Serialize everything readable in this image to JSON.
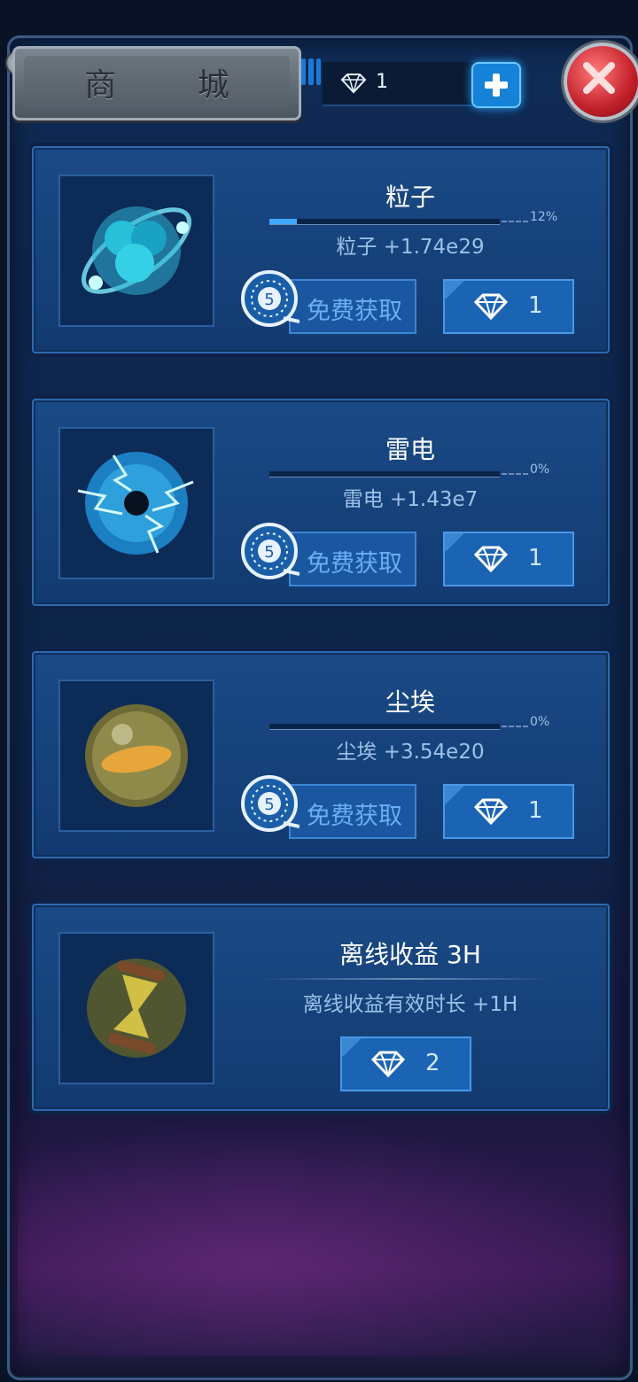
{
  "header": {
    "title": "商 城",
    "gem_count": "1"
  },
  "items": [
    {
      "name": "粒子",
      "progress_label": "12%",
      "progress": 0.12,
      "gain": "粒子  +1.74e29",
      "free_count": "5",
      "free_label": "免费获取",
      "price": "1"
    },
    {
      "name": "雷电",
      "progress_label": "0%",
      "progress": 0.0,
      "gain": "雷电  +1.43e7",
      "free_count": "5",
      "free_label": "免费获取",
      "price": "1"
    },
    {
      "name": "尘埃",
      "progress_label": "0%",
      "progress": 0.0,
      "gain": "尘埃  +3.54e20",
      "free_count": "5",
      "free_label": "免费获取",
      "price": "1"
    }
  ],
  "offline": {
    "name": "离线收益 3H",
    "desc": "离线收益有效时长  +1H",
    "price": "2"
  },
  "colors": {
    "accent": "#1683d8",
    "close": "#c2202a",
    "panel": "#123a70"
  },
  "icons": {
    "currency": "diamond-icon",
    "add": "plus-icon",
    "close": "close-icon",
    "video": "film-reel-icon"
  }
}
